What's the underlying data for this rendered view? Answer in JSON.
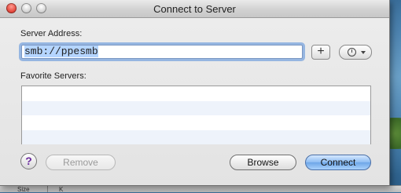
{
  "window": {
    "title": "Connect to Server"
  },
  "server_address": {
    "label": "Server Address:",
    "value": "smb://ppesmb"
  },
  "buttons": {
    "add": "+",
    "help": "?",
    "remove": "Remove",
    "browse": "Browse",
    "connect": "Connect"
  },
  "favorites": {
    "label": "Favorite Servers:",
    "rows": [
      "",
      "",
      "",
      ""
    ]
  },
  "background_strip": {
    "col1": "Size",
    "col2": "K"
  },
  "colors": {
    "accent": "#6ea6e8",
    "focus_ring": "#689adb",
    "help_icon": "#6a2a9e"
  }
}
